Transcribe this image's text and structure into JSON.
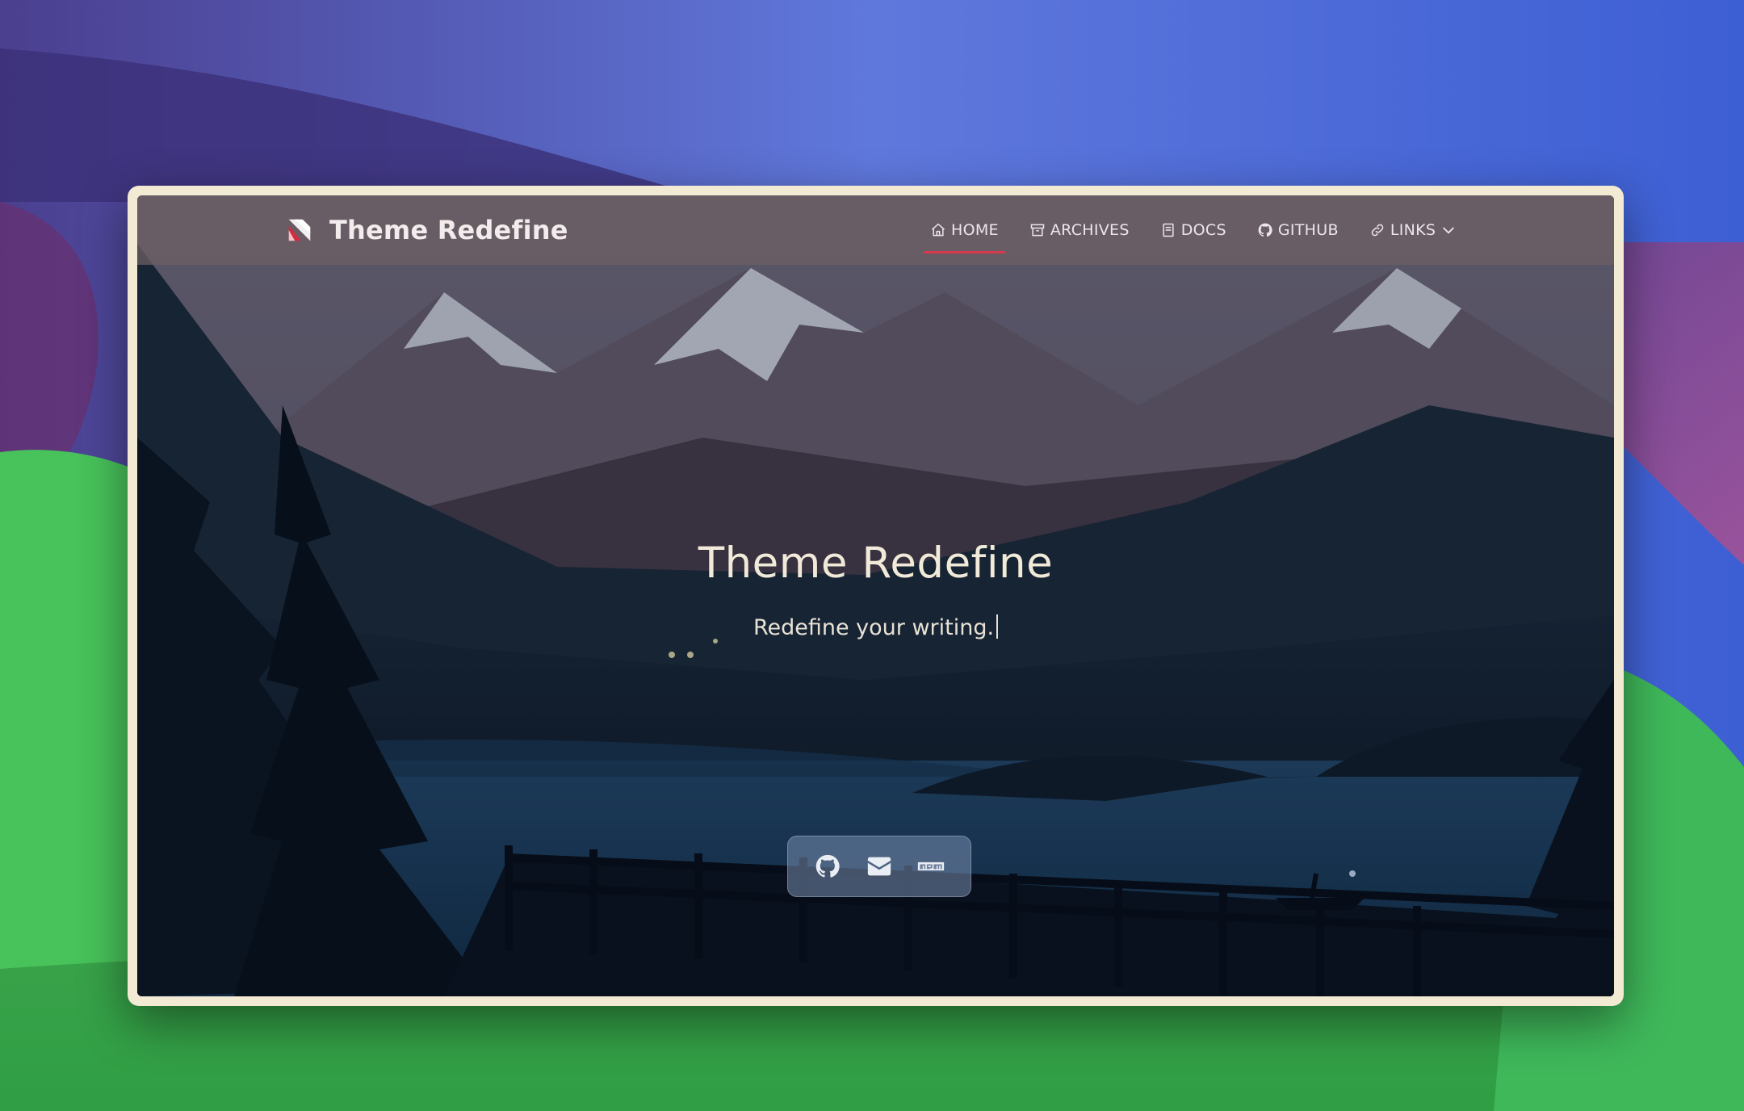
{
  "navbar": {
    "brand_title": "Theme Redefine",
    "items": [
      {
        "label": "HOME",
        "icon": "home-icon",
        "active": true
      },
      {
        "label": "ARCHIVES",
        "icon": "archive-icon"
      },
      {
        "label": "DOCS",
        "icon": "book-icon"
      },
      {
        "label": "GITHUB",
        "icon": "github-icon"
      },
      {
        "label": "LINKS",
        "icon": "link-icon"
      }
    ]
  },
  "hero": {
    "title": "Theme Redefine",
    "subtitle": "Redefine your writing."
  },
  "social": [
    "github-icon",
    "mail-icon",
    "npm-icon"
  ],
  "colors": {
    "frame": "#f3ead4",
    "accent": "#d63a4e",
    "navbar": "#6e6064"
  }
}
